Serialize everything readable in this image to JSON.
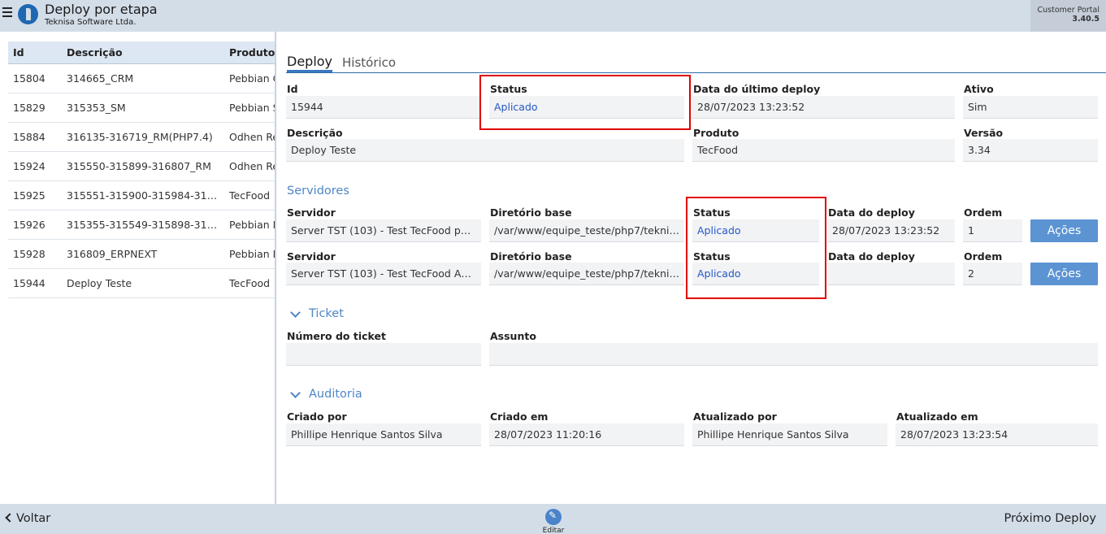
{
  "header": {
    "title": "Deploy por etapa",
    "subtitle": "Teknisa Software Ltda.",
    "portal_name": "Customer Portal",
    "portal_version": "3.40.5"
  },
  "list": {
    "columns": [
      "Id",
      "Descrição",
      "Produto"
    ],
    "rows": [
      {
        "id": "15804",
        "desc": "314665_CRM",
        "prod": "Pebbian C"
      },
      {
        "id": "15829",
        "desc": "315353_SM",
        "prod": "Pebbian S"
      },
      {
        "id": "15884",
        "desc": "316135-316719_RM(PHP7.4)",
        "prod": "Odhen Re"
      },
      {
        "id": "15924",
        "desc": "315550-315899-316807_RM",
        "prod": "Odhen Re"
      },
      {
        "id": "15925",
        "desc": "315551-315900-315984-3168...",
        "prod": "TecFood"
      },
      {
        "id": "15926",
        "desc": "315355-315549-315898-3168...",
        "prod": "Pebbian E"
      },
      {
        "id": "15928",
        "desc": "316809_ERPNEXT",
        "prod": "Pebbian E"
      },
      {
        "id": "15944",
        "desc": "Deploy Teste",
        "prod": "TecFood"
      }
    ]
  },
  "tabs": [
    "Deploy",
    "Histórico"
  ],
  "deploy": {
    "id_label": "Id",
    "id_value": "15944",
    "status_label": "Status",
    "status_value": "Aplicado",
    "last_deploy_label": "Data do último deploy",
    "last_deploy_value": "28/07/2023 13:23:52",
    "active_label": "Ativo",
    "active_value": "Sim",
    "desc_label": "Descrição",
    "desc_value": "Deploy Teste",
    "product_label": "Produto",
    "product_value": "TecFood",
    "version_label": "Versão",
    "version_value": "3.34"
  },
  "servers": {
    "section_title": "Servidores",
    "labels": {
      "server": "Servidor",
      "dir": "Diretório base",
      "status": "Status",
      "date": "Data do deploy",
      "order": "Ordem"
    },
    "action_label": "Ações",
    "rows": [
      {
        "server": "Server TST (103) - Test TecFood php7 ...",
        "dir": "/var/www/equipe_teste/php7/teknis...",
        "status": "Aplicado",
        "date": "28/07/2023 13:23:52",
        "order": "1"
      },
      {
        "server": "Server TST (103) - Test TecFood Auto...",
        "dir": "/var/www/equipe_teste/php7/teknis...",
        "status": "Aplicado",
        "date": "",
        "order": "2"
      }
    ]
  },
  "ticket": {
    "section_title": "Ticket",
    "number_label": "Número do ticket",
    "number_value": "",
    "subject_label": "Assunto",
    "subject_value": ""
  },
  "audit": {
    "section_title": "Auditoria",
    "created_by_label": "Criado por",
    "created_by_value": "Phillipe Henrique Santos Silva",
    "created_at_label": "Criado em",
    "created_at_value": "28/07/2023 11:20:16",
    "updated_by_label": "Atualizado por",
    "updated_by_value": "Phillipe Henrique Santos Silva",
    "updated_at_label": "Atualizado em",
    "updated_at_value": "28/07/2023 13:23:54"
  },
  "footer": {
    "back_label": "Voltar",
    "edit_label": "Editar",
    "next_label": "Próximo Deploy"
  },
  "colors": {
    "accent": "#4f86c6",
    "status_text": "#2557c4",
    "highlight_box": "#e00000",
    "bar": "#d3dde8"
  }
}
